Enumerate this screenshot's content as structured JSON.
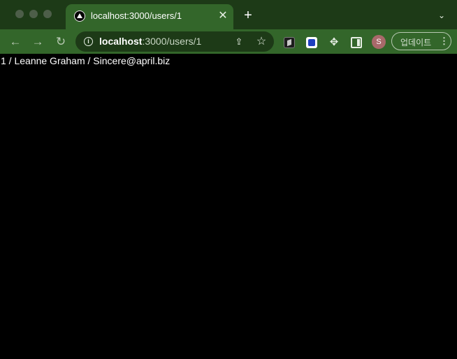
{
  "tab": {
    "title": "localhost:3000/users/1",
    "close_glyph": "✕",
    "favicon": "triangle-favicon-icon"
  },
  "tabstrip": {
    "new_tab_glyph": "+",
    "search_tabs_glyph": "⌄"
  },
  "toolbar": {
    "back_glyph": "←",
    "forward_glyph": "→",
    "reload_glyph": "↻",
    "info_glyph": "i",
    "share_glyph": "⇪",
    "star_glyph": "☆",
    "puzzle_glyph": "✥",
    "avatar_initial": "S",
    "update_label": "업데이트",
    "menu_glyph": "⋮"
  },
  "address_bar": {
    "host": "localhost",
    "path": ":3000/users/1"
  },
  "page": {
    "text": "1 / Leanne Graham / Sincere@april.biz"
  },
  "colors": {
    "tabstrip": "#1d3a17",
    "toolbar": "#33662a",
    "page_background": "#000000",
    "page_text": "#ffffff"
  }
}
